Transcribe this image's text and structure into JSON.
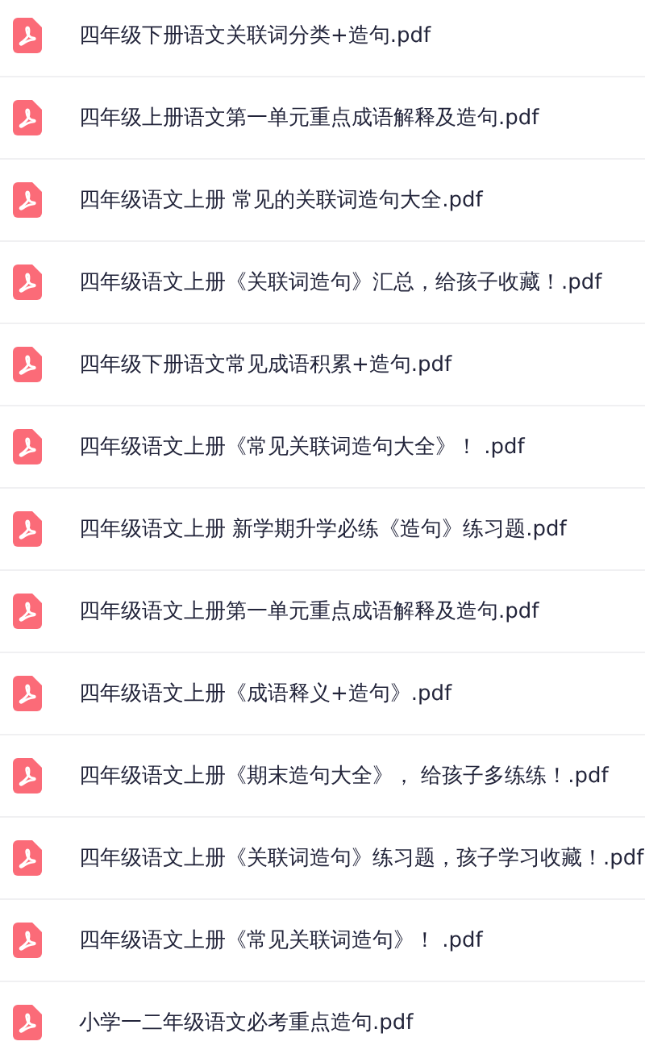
{
  "files": [
    {
      "name": "四年级下册语文关联词分类+造句.pdf",
      "kind": "pdf"
    },
    {
      "name": "四年级上册语文第一单元重点成语解释及造句.pdf",
      "kind": "pdf"
    },
    {
      "name": "四年级语文上册 常见的关联词造句大全.pdf",
      "kind": "pdf"
    },
    {
      "name": "四年级语文上册《关联词造句》汇总，给孩子收藏！.pdf",
      "kind": "pdf"
    },
    {
      "name": "四年级下册语文常见成语积累+造句.pdf",
      "kind": "pdf"
    },
    {
      "name": "四年级语文上册《常见关联词造句大全》！ .pdf",
      "kind": "pdf"
    },
    {
      "name": "四年级语文上册 新学期升学必练《造句》练习题.pdf",
      "kind": "pdf"
    },
    {
      "name": "四年级语文上册第一单元重点成语解释及造句.pdf",
      "kind": "pdf"
    },
    {
      "name": "四年级语文上册《成语释义+造句》.pdf",
      "kind": "pdf"
    },
    {
      "name": "四年级语文上册《期末造句大全》， 给孩子多练练！.pdf",
      "kind": "pdf"
    },
    {
      "name": "四年级语文上册《关联词造句》练习题，孩子学习收藏！.pdf",
      "kind": "pdf"
    },
    {
      "name": "四年级语文上册《常见关联词造句》！ .pdf",
      "kind": "pdf"
    },
    {
      "name": "小学一二年级语文必考重点造句.pdf",
      "kind": "pdf"
    }
  ]
}
